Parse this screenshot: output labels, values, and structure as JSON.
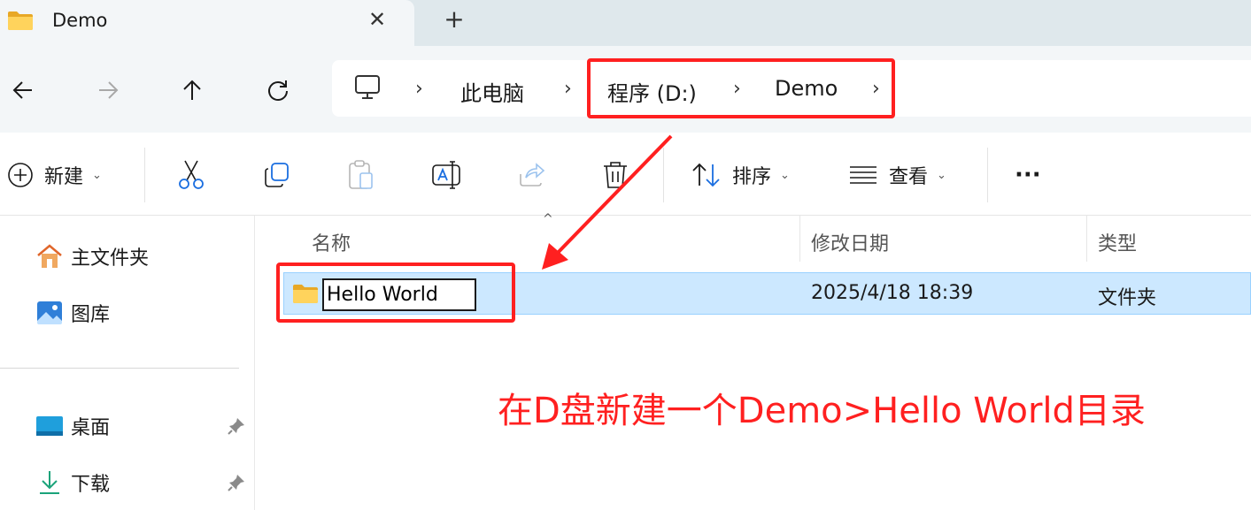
{
  "window": {
    "tab_title": "Demo",
    "close_glyph": "✕",
    "new_tab_glyph": "+"
  },
  "nav": {
    "back_icon": "arrow-left-icon",
    "forward_icon": "arrow-right-icon",
    "up_icon": "arrow-up-icon",
    "refresh_icon": "refresh-icon"
  },
  "breadcrumb": {
    "items": [
      "此电脑",
      "程序 (D:)",
      "Demo"
    ],
    "separator": "›"
  },
  "toolbar": {
    "new_label": "新建",
    "sort_label": "排序",
    "view_label": "查看",
    "more_label": "···",
    "caret": "⌄"
  },
  "sidebar": {
    "items": [
      {
        "label": "主文件夹",
        "icon": "home-icon"
      },
      {
        "label": "图库",
        "icon": "gallery-icon"
      },
      {
        "label": "桌面",
        "icon": "desktop-icon",
        "pinned": true
      },
      {
        "label": "下载",
        "icon": "download-icon",
        "pinned": true
      }
    ]
  },
  "filelist": {
    "columns": [
      "名称",
      "修改日期",
      "类型"
    ],
    "sort_indicator": "^",
    "rows": [
      {
        "name": "Hello World",
        "modified": "2025/4/18 18:39",
        "type": "文件夹",
        "selected": true,
        "renaming": true
      }
    ]
  },
  "annotation": {
    "text": "在D盘新建一个Demo>Hello World目录",
    "color": "#ff2020"
  },
  "colors": {
    "selection": "#cce8ff",
    "selection_border": "#99d1ff",
    "folder": "#f5c542",
    "tabstrip": "#dfe8ec",
    "chrome": "#f3f6f8"
  }
}
